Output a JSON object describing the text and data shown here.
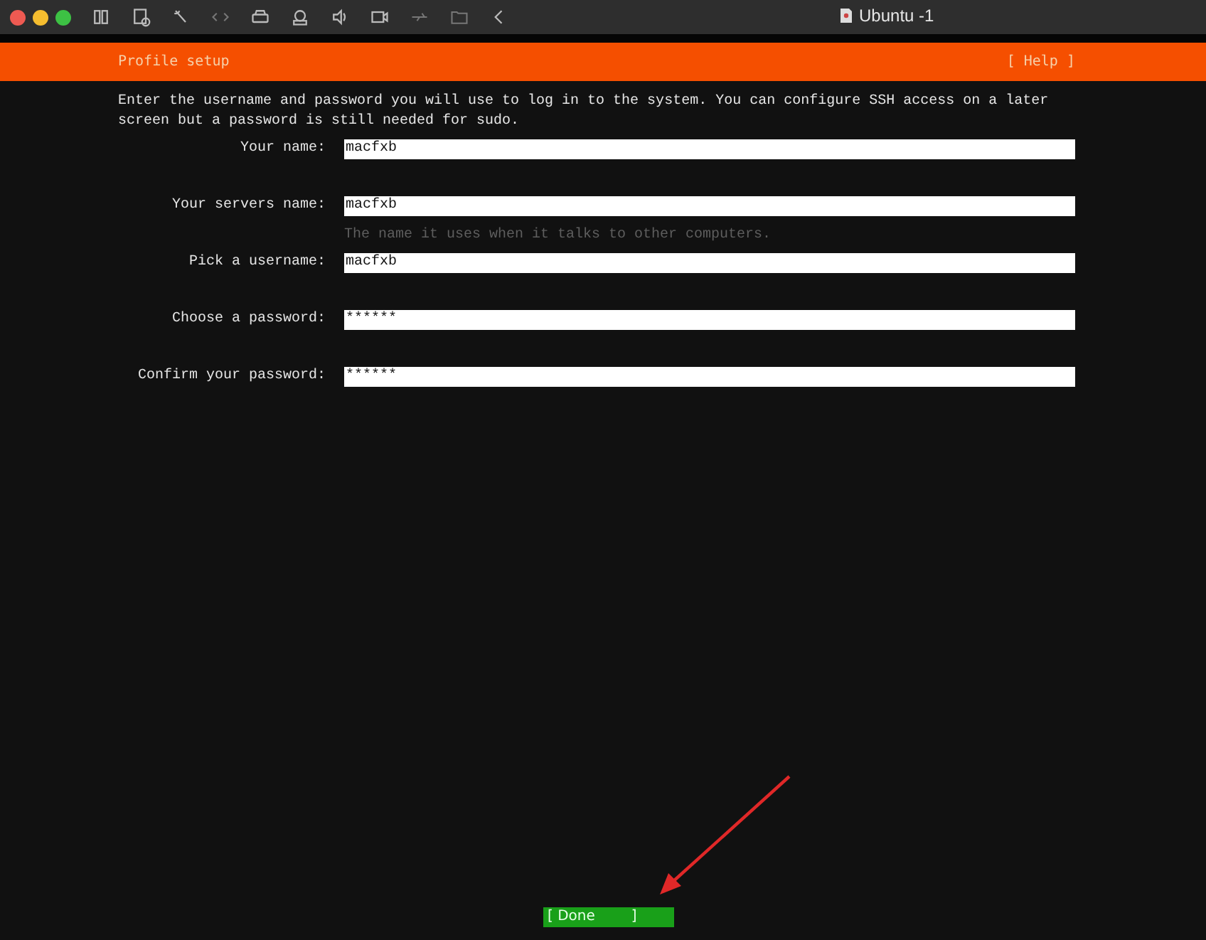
{
  "window": {
    "title": "Ubuntu -1"
  },
  "header": {
    "title": "Profile setup",
    "help": "[ Help ]"
  },
  "intro": "Enter the username and password you will use to log in to the system. You can configure SSH access on a later screen but a password is still needed for sudo.",
  "fields": [
    {
      "label": "Your name:",
      "value": "macfxb"
    },
    {
      "label": "Your servers name:",
      "value": "macfxb",
      "hint": "The name it uses when it talks to other computers."
    },
    {
      "label": "Pick a username:",
      "value": "macfxb"
    },
    {
      "label": "Choose a password:",
      "value": "******"
    },
    {
      "label": "Confirm your password:",
      "value": "******"
    }
  ],
  "done_button": {
    "label": "[ Done        ]"
  }
}
